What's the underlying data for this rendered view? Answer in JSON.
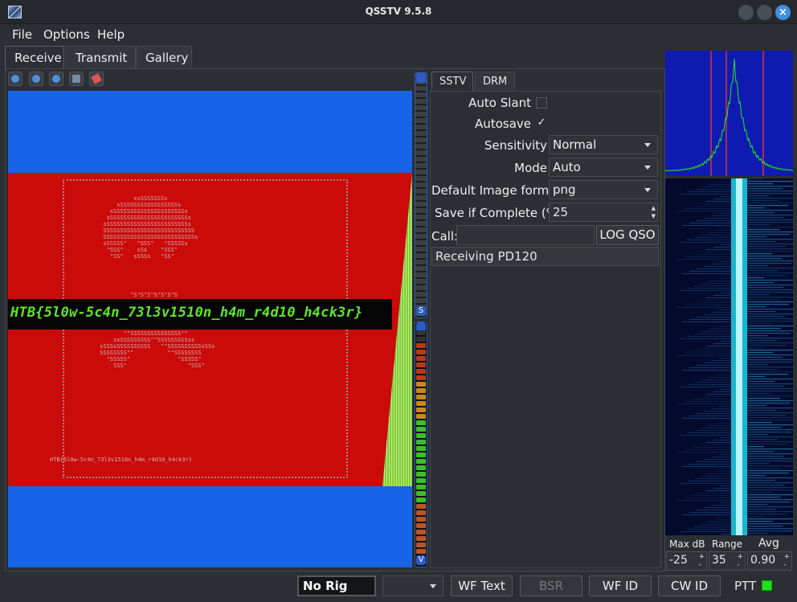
{
  "window": {
    "title": "QSSTV 9.5.8"
  },
  "menu": {
    "items": [
      "File",
      "Options",
      "Help"
    ]
  },
  "main_tabs": {
    "receive": "Receive",
    "transmit": "Transmit",
    "gallery": "Gallery"
  },
  "toolbar": {
    "icons": [
      "start-icon",
      "stop-icon",
      "refresh-icon",
      "save-icon",
      "erase-icon"
    ]
  },
  "image": {
    "flag_banner": "HTB{5l0w-5c4n_73l3v1510n_h4m_r4d10_h4ck3r}",
    "small_flag": "HTB{5l0w-5c4n_73l3v1510n_h4m_r4d10_h4ck3r}",
    "colors": {
      "background": "#1764e6",
      "band": "#cb0a0a",
      "flag_text": "#5fe62b"
    }
  },
  "meters": {
    "sync_cap_label": "S",
    "vu_cap_label": "V"
  },
  "mode_tabs": {
    "sstv": "SSTV",
    "drm": "DRM"
  },
  "settings": {
    "auto_slant": {
      "label": "Auto Slant",
      "checked": false,
      "mark": ""
    },
    "autosave": {
      "label": "Autosave",
      "checked": true,
      "mark": "✓"
    },
    "sensitivity": {
      "label": "Sensitivity",
      "value": "Normal"
    },
    "mode": {
      "label": "Mode",
      "value": "Auto"
    },
    "image_format": {
      "label": "Default Image format",
      "value": "png"
    },
    "save_if_complete": {
      "label": "Save if Complete (%)",
      "value": "25"
    },
    "call": {
      "label": "Call:",
      "value": ""
    },
    "log_qso": "LOG QSO",
    "status": "Receiving PD120"
  },
  "waterfall": {
    "max_db_label": "Max dB",
    "range_label": "Range",
    "avg_label": "Avg",
    "max_db": "-25",
    "range": "35",
    "avg": "0.90"
  },
  "statusbar": {
    "rig": "No Rig",
    "wf_text": "WF Text",
    "bsr": "BSR",
    "wf_id": "WF ID",
    "cw_id": "CW ID",
    "ptt": "PTT",
    "ptt_color": "#1ee01e"
  }
}
